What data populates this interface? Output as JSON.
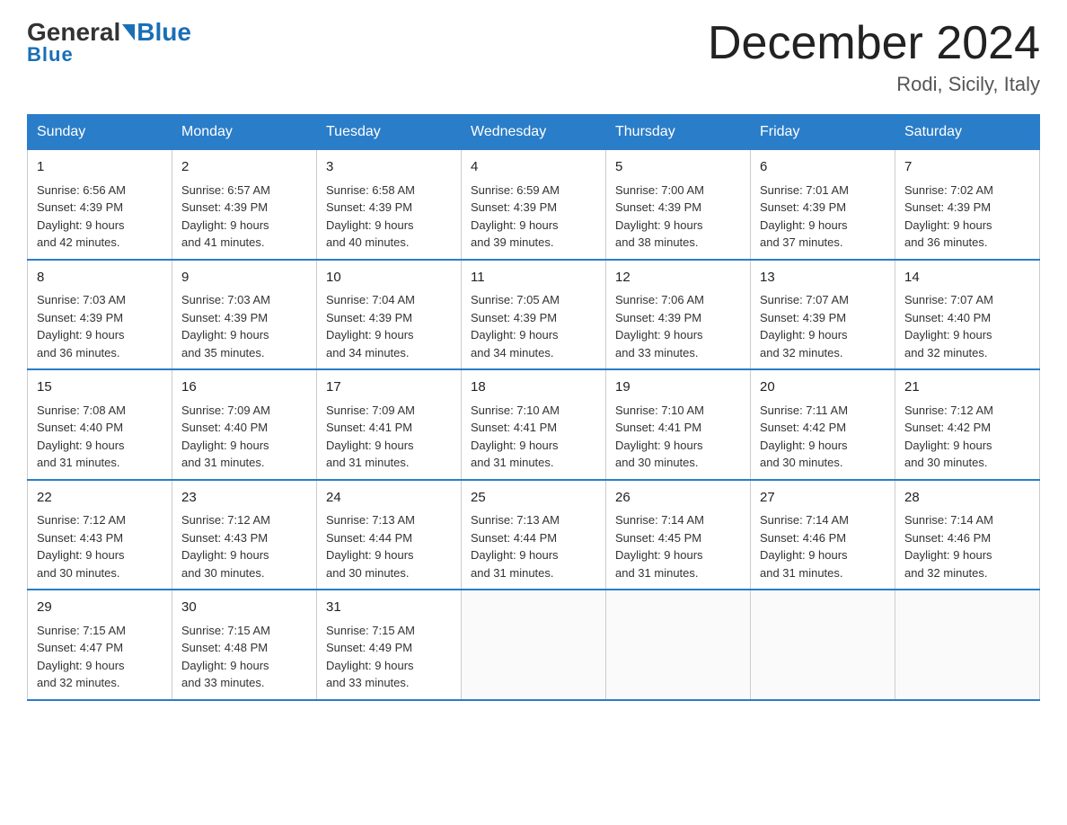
{
  "header": {
    "logo_general": "General",
    "logo_blue": "Blue",
    "month_title": "December 2024",
    "location": "Rodi, Sicily, Italy"
  },
  "days_of_week": [
    "Sunday",
    "Monday",
    "Tuesday",
    "Wednesday",
    "Thursday",
    "Friday",
    "Saturday"
  ],
  "weeks": [
    [
      {
        "day": "1",
        "sunrise": "6:56 AM",
        "sunset": "4:39 PM",
        "daylight": "9 hours and 42 minutes."
      },
      {
        "day": "2",
        "sunrise": "6:57 AM",
        "sunset": "4:39 PM",
        "daylight": "9 hours and 41 minutes."
      },
      {
        "day": "3",
        "sunrise": "6:58 AM",
        "sunset": "4:39 PM",
        "daylight": "9 hours and 40 minutes."
      },
      {
        "day": "4",
        "sunrise": "6:59 AM",
        "sunset": "4:39 PM",
        "daylight": "9 hours and 39 minutes."
      },
      {
        "day": "5",
        "sunrise": "7:00 AM",
        "sunset": "4:39 PM",
        "daylight": "9 hours and 38 minutes."
      },
      {
        "day": "6",
        "sunrise": "7:01 AM",
        "sunset": "4:39 PM",
        "daylight": "9 hours and 37 minutes."
      },
      {
        "day": "7",
        "sunrise": "7:02 AM",
        "sunset": "4:39 PM",
        "daylight": "9 hours and 36 minutes."
      }
    ],
    [
      {
        "day": "8",
        "sunrise": "7:03 AM",
        "sunset": "4:39 PM",
        "daylight": "9 hours and 36 minutes."
      },
      {
        "day": "9",
        "sunrise": "7:03 AM",
        "sunset": "4:39 PM",
        "daylight": "9 hours and 35 minutes."
      },
      {
        "day": "10",
        "sunrise": "7:04 AM",
        "sunset": "4:39 PM",
        "daylight": "9 hours and 34 minutes."
      },
      {
        "day": "11",
        "sunrise": "7:05 AM",
        "sunset": "4:39 PM",
        "daylight": "9 hours and 34 minutes."
      },
      {
        "day": "12",
        "sunrise": "7:06 AM",
        "sunset": "4:39 PM",
        "daylight": "9 hours and 33 minutes."
      },
      {
        "day": "13",
        "sunrise": "7:07 AM",
        "sunset": "4:39 PM",
        "daylight": "9 hours and 32 minutes."
      },
      {
        "day": "14",
        "sunrise": "7:07 AM",
        "sunset": "4:40 PM",
        "daylight": "9 hours and 32 minutes."
      }
    ],
    [
      {
        "day": "15",
        "sunrise": "7:08 AM",
        "sunset": "4:40 PM",
        "daylight": "9 hours and 31 minutes."
      },
      {
        "day": "16",
        "sunrise": "7:09 AM",
        "sunset": "4:40 PM",
        "daylight": "9 hours and 31 minutes."
      },
      {
        "day": "17",
        "sunrise": "7:09 AM",
        "sunset": "4:41 PM",
        "daylight": "9 hours and 31 minutes."
      },
      {
        "day": "18",
        "sunrise": "7:10 AM",
        "sunset": "4:41 PM",
        "daylight": "9 hours and 31 minutes."
      },
      {
        "day": "19",
        "sunrise": "7:10 AM",
        "sunset": "4:41 PM",
        "daylight": "9 hours and 30 minutes."
      },
      {
        "day": "20",
        "sunrise": "7:11 AM",
        "sunset": "4:42 PM",
        "daylight": "9 hours and 30 minutes."
      },
      {
        "day": "21",
        "sunrise": "7:12 AM",
        "sunset": "4:42 PM",
        "daylight": "9 hours and 30 minutes."
      }
    ],
    [
      {
        "day": "22",
        "sunrise": "7:12 AM",
        "sunset": "4:43 PM",
        "daylight": "9 hours and 30 minutes."
      },
      {
        "day": "23",
        "sunrise": "7:12 AM",
        "sunset": "4:43 PM",
        "daylight": "9 hours and 30 minutes."
      },
      {
        "day": "24",
        "sunrise": "7:13 AM",
        "sunset": "4:44 PM",
        "daylight": "9 hours and 30 minutes."
      },
      {
        "day": "25",
        "sunrise": "7:13 AM",
        "sunset": "4:44 PM",
        "daylight": "9 hours and 31 minutes."
      },
      {
        "day": "26",
        "sunrise": "7:14 AM",
        "sunset": "4:45 PM",
        "daylight": "9 hours and 31 minutes."
      },
      {
        "day": "27",
        "sunrise": "7:14 AM",
        "sunset": "4:46 PM",
        "daylight": "9 hours and 31 minutes."
      },
      {
        "day": "28",
        "sunrise": "7:14 AM",
        "sunset": "4:46 PM",
        "daylight": "9 hours and 32 minutes."
      }
    ],
    [
      {
        "day": "29",
        "sunrise": "7:15 AM",
        "sunset": "4:47 PM",
        "daylight": "9 hours and 32 minutes."
      },
      {
        "day": "30",
        "sunrise": "7:15 AM",
        "sunset": "4:48 PM",
        "daylight": "9 hours and 33 minutes."
      },
      {
        "day": "31",
        "sunrise": "7:15 AM",
        "sunset": "4:49 PM",
        "daylight": "9 hours and 33 minutes."
      },
      null,
      null,
      null,
      null
    ]
  ],
  "labels": {
    "sunrise": "Sunrise:",
    "sunset": "Sunset:",
    "daylight": "Daylight:"
  }
}
